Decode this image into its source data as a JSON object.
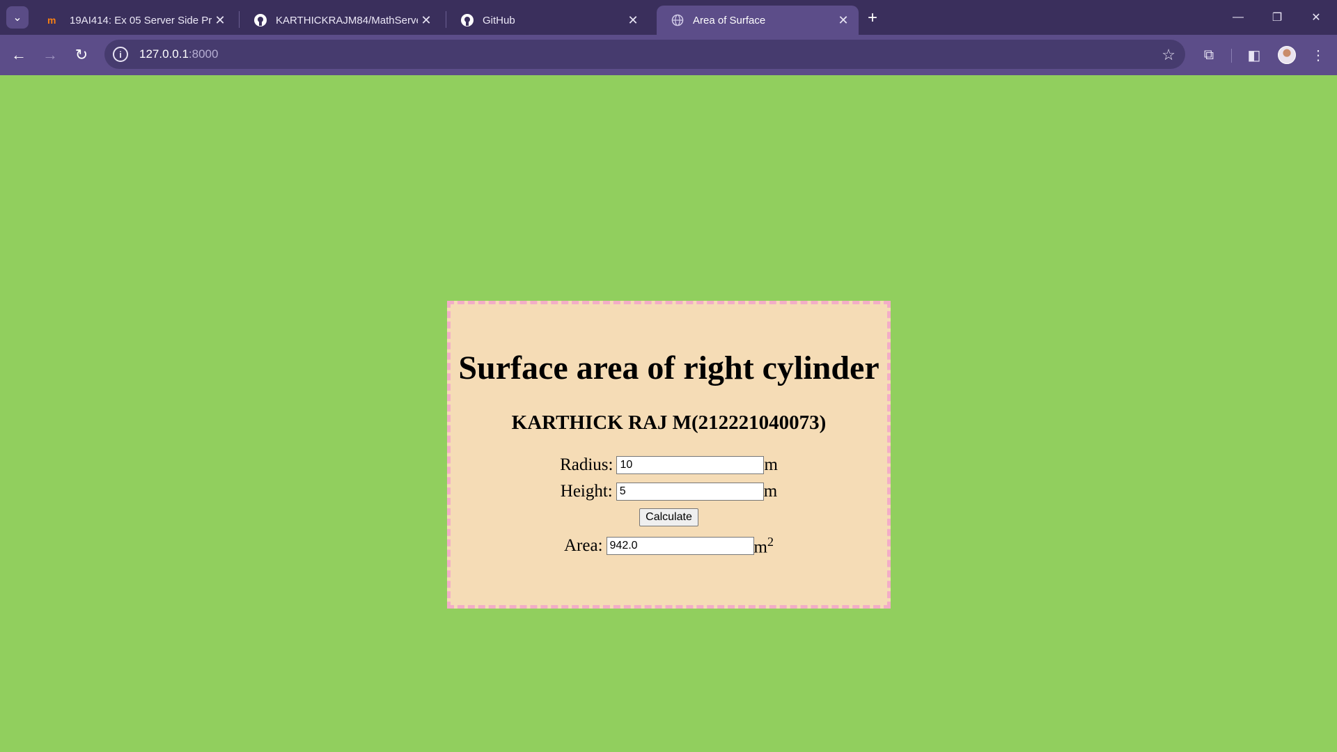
{
  "browser": {
    "tabs": [
      {
        "title": "19AI414: Ex 05 Server Side Proc",
        "active": false
      },
      {
        "title": "KARTHICKRAJM84/MathServer",
        "active": false
      },
      {
        "title": "GitHub",
        "active": false
      },
      {
        "title": "Area of Surface",
        "active": true
      }
    ],
    "url_host": "127.0.0.1",
    "url_port": ":8000"
  },
  "page": {
    "heading": "Surface area of right cylinder",
    "author": "KARTHICK RAJ M(212221040073)",
    "radius": {
      "label": "Radius:",
      "value": "10",
      "unit": "m"
    },
    "height": {
      "label": "Height:",
      "value": "5",
      "unit": "m"
    },
    "calculate_label": "Calculate",
    "area": {
      "label": "Area:",
      "value": "942.0",
      "unit": "m",
      "unit_exp": "2"
    }
  },
  "colors": {
    "page_background": "#91cf5e",
    "card_background": "#f5dcb6",
    "card_border": "#f3adc7",
    "browser_frame": "#3a2f5c",
    "browser_toolbar": "#5c4d89"
  }
}
